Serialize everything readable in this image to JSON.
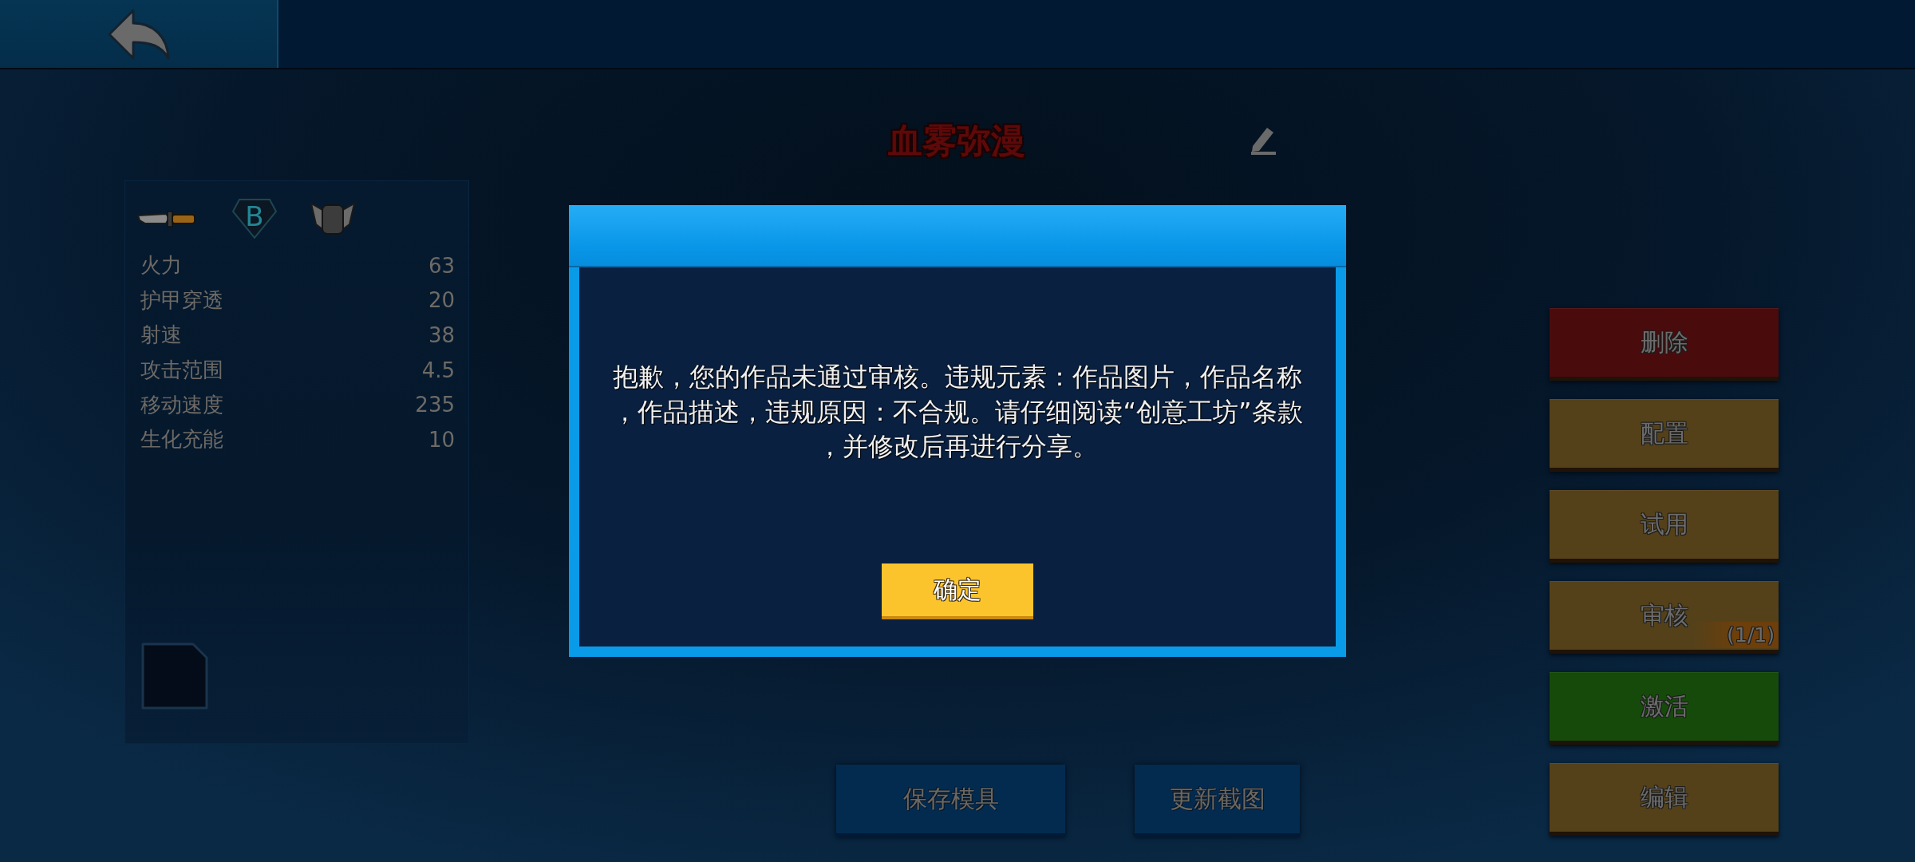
{
  "title": "血雾弥漫",
  "stats_panel": {
    "grade": "B",
    "stats": [
      {
        "label": "火力",
        "value": "63"
      },
      {
        "label": "护甲穿透",
        "value": "20"
      },
      {
        "label": "射速",
        "value": "38"
      },
      {
        "label": "攻击范围",
        "value": "4.5"
      },
      {
        "label": "移动速度",
        "value": "235"
      },
      {
        "label": "生化充能",
        "value": "10"
      }
    ]
  },
  "side_buttons": [
    {
      "label": "删除",
      "color": "#4a0b0d"
    },
    {
      "label": "配置",
      "color": "#54411a"
    },
    {
      "label": "试用",
      "color": "#54411a"
    },
    {
      "label": "审核",
      "color": "#54411a",
      "badge": "(1/1)"
    },
    {
      "label": "激活",
      "color": "#164a0b"
    },
    {
      "label": "编辑",
      "color": "#54411a"
    }
  ],
  "bottom_buttons": [
    {
      "label": "保存模具"
    },
    {
      "label": "更新截图"
    }
  ],
  "dialog": {
    "message": "抱歉，您的作品未通过审核。违规元素：作品图片，作品名称，作品描述，违规原因：不合规。请仔细阅读“创意工坊”条款，并修改后再进行分享。",
    "confirm_button": "确定"
  }
}
